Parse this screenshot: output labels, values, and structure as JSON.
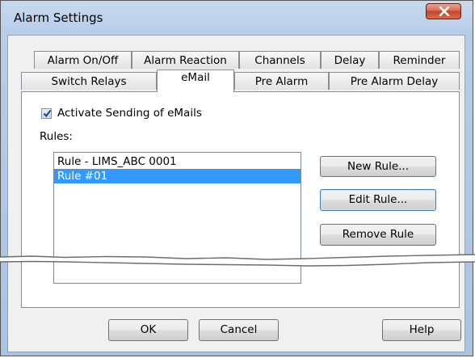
{
  "window": {
    "title": "Alarm Settings",
    "close_icon": "close-x-icon"
  },
  "tabs_row_back": [
    {
      "label": "Alarm On/Off"
    },
    {
      "label": "Alarm Reaction"
    },
    {
      "label": "Channels"
    },
    {
      "label": "Delay"
    },
    {
      "label": "Reminder"
    }
  ],
  "tabs_row_front": [
    {
      "label": "Switch Relays"
    },
    {
      "label": "eMail",
      "active": true
    },
    {
      "label": "Pre Alarm"
    },
    {
      "label": "Pre Alarm Delay"
    }
  ],
  "email_tab": {
    "activate_checkbox": {
      "label": "Activate Sending of eMails",
      "checked": true
    },
    "rules_label": "Rules:",
    "rules": [
      {
        "label": "Rule - LIMS_ABC 0001",
        "selected": false
      },
      {
        "label": "Rule #01",
        "selected": true
      }
    ],
    "new_rule_button": "New Rule...",
    "edit_rule_button": "Edit Rule...",
    "remove_rule_button": "Remove Rule"
  },
  "footer": {
    "ok_button": "OK",
    "cancel_button": "Cancel",
    "help_button": "Help"
  },
  "colors": {
    "selection": "#3399ff",
    "frame": "#b7cde8"
  }
}
